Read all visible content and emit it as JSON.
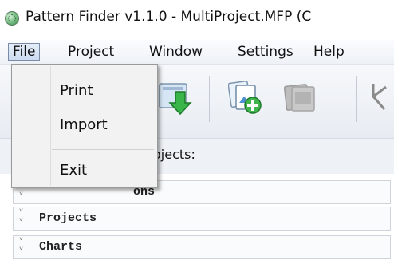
{
  "window": {
    "title": "Pattern Finder v1.1.0 - MultiProject.MFP (C"
  },
  "menubar": {
    "items": [
      {
        "label": "File"
      },
      {
        "label": "Project"
      },
      {
        "label": "Window"
      },
      {
        "label": "Settings"
      },
      {
        "label": "Help"
      }
    ]
  },
  "file_menu": {
    "items": [
      {
        "label": "Print"
      },
      {
        "label": "Import"
      },
      {
        "label": "Exit"
      }
    ]
  },
  "toolbar": {
    "buttons": [
      {
        "icon": "import-download-icon"
      },
      {
        "icon": "add-project-icon"
      },
      {
        "icon": "remove-project-icon"
      },
      {
        "icon": "tree-branch-icon"
      }
    ]
  },
  "panel": {
    "projects_label": "ojects:"
  },
  "tree": {
    "rows": [
      {
        "label": "ons"
      },
      {
        "label": "Projects"
      },
      {
        "label": "Charts"
      }
    ]
  }
}
